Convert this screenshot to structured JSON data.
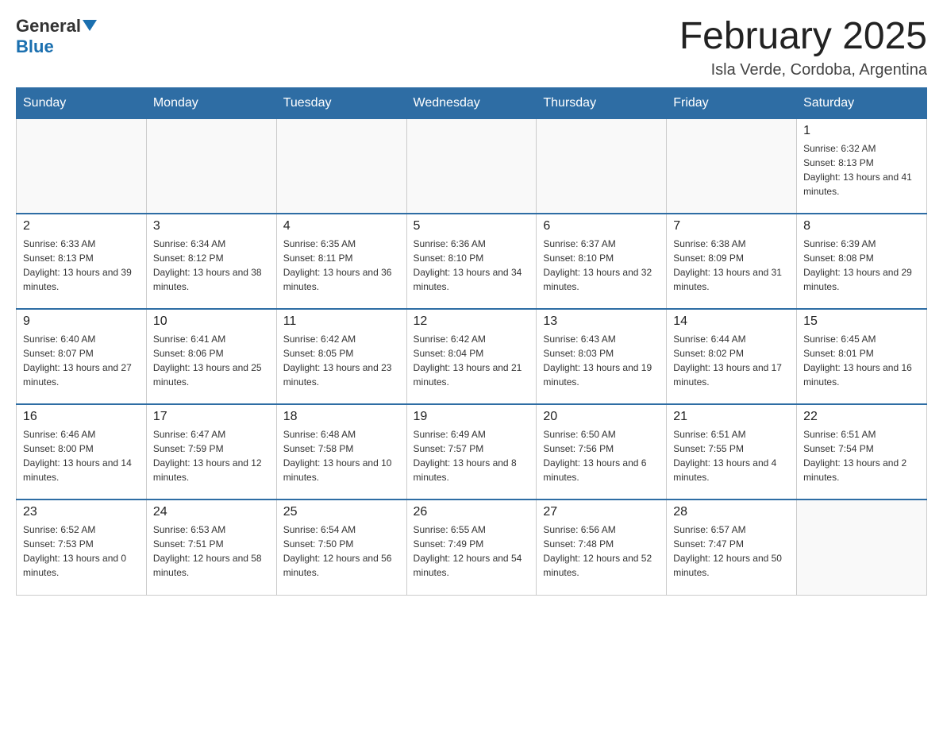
{
  "header": {
    "logo": {
      "general": "General",
      "arrow": "▲",
      "blue": "Blue"
    },
    "title": "February 2025",
    "location": "Isla Verde, Cordoba, Argentina"
  },
  "calendar": {
    "days_of_week": [
      "Sunday",
      "Monday",
      "Tuesday",
      "Wednesday",
      "Thursday",
      "Friday",
      "Saturday"
    ],
    "weeks": [
      [
        {
          "day": "",
          "info": ""
        },
        {
          "day": "",
          "info": ""
        },
        {
          "day": "",
          "info": ""
        },
        {
          "day": "",
          "info": ""
        },
        {
          "day": "",
          "info": ""
        },
        {
          "day": "",
          "info": ""
        },
        {
          "day": "1",
          "info": "Sunrise: 6:32 AM\nSunset: 8:13 PM\nDaylight: 13 hours and 41 minutes."
        }
      ],
      [
        {
          "day": "2",
          "info": "Sunrise: 6:33 AM\nSunset: 8:13 PM\nDaylight: 13 hours and 39 minutes."
        },
        {
          "day": "3",
          "info": "Sunrise: 6:34 AM\nSunset: 8:12 PM\nDaylight: 13 hours and 38 minutes."
        },
        {
          "day": "4",
          "info": "Sunrise: 6:35 AM\nSunset: 8:11 PM\nDaylight: 13 hours and 36 minutes."
        },
        {
          "day": "5",
          "info": "Sunrise: 6:36 AM\nSunset: 8:10 PM\nDaylight: 13 hours and 34 minutes."
        },
        {
          "day": "6",
          "info": "Sunrise: 6:37 AM\nSunset: 8:10 PM\nDaylight: 13 hours and 32 minutes."
        },
        {
          "day": "7",
          "info": "Sunrise: 6:38 AM\nSunset: 8:09 PM\nDaylight: 13 hours and 31 minutes."
        },
        {
          "day": "8",
          "info": "Sunrise: 6:39 AM\nSunset: 8:08 PM\nDaylight: 13 hours and 29 minutes."
        }
      ],
      [
        {
          "day": "9",
          "info": "Sunrise: 6:40 AM\nSunset: 8:07 PM\nDaylight: 13 hours and 27 minutes."
        },
        {
          "day": "10",
          "info": "Sunrise: 6:41 AM\nSunset: 8:06 PM\nDaylight: 13 hours and 25 minutes."
        },
        {
          "day": "11",
          "info": "Sunrise: 6:42 AM\nSunset: 8:05 PM\nDaylight: 13 hours and 23 minutes."
        },
        {
          "day": "12",
          "info": "Sunrise: 6:42 AM\nSunset: 8:04 PM\nDaylight: 13 hours and 21 minutes."
        },
        {
          "day": "13",
          "info": "Sunrise: 6:43 AM\nSunset: 8:03 PM\nDaylight: 13 hours and 19 minutes."
        },
        {
          "day": "14",
          "info": "Sunrise: 6:44 AM\nSunset: 8:02 PM\nDaylight: 13 hours and 17 minutes."
        },
        {
          "day": "15",
          "info": "Sunrise: 6:45 AM\nSunset: 8:01 PM\nDaylight: 13 hours and 16 minutes."
        }
      ],
      [
        {
          "day": "16",
          "info": "Sunrise: 6:46 AM\nSunset: 8:00 PM\nDaylight: 13 hours and 14 minutes."
        },
        {
          "day": "17",
          "info": "Sunrise: 6:47 AM\nSunset: 7:59 PM\nDaylight: 13 hours and 12 minutes."
        },
        {
          "day": "18",
          "info": "Sunrise: 6:48 AM\nSunset: 7:58 PM\nDaylight: 13 hours and 10 minutes."
        },
        {
          "day": "19",
          "info": "Sunrise: 6:49 AM\nSunset: 7:57 PM\nDaylight: 13 hours and 8 minutes."
        },
        {
          "day": "20",
          "info": "Sunrise: 6:50 AM\nSunset: 7:56 PM\nDaylight: 13 hours and 6 minutes."
        },
        {
          "day": "21",
          "info": "Sunrise: 6:51 AM\nSunset: 7:55 PM\nDaylight: 13 hours and 4 minutes."
        },
        {
          "day": "22",
          "info": "Sunrise: 6:51 AM\nSunset: 7:54 PM\nDaylight: 13 hours and 2 minutes."
        }
      ],
      [
        {
          "day": "23",
          "info": "Sunrise: 6:52 AM\nSunset: 7:53 PM\nDaylight: 13 hours and 0 minutes."
        },
        {
          "day": "24",
          "info": "Sunrise: 6:53 AM\nSunset: 7:51 PM\nDaylight: 12 hours and 58 minutes."
        },
        {
          "day": "25",
          "info": "Sunrise: 6:54 AM\nSunset: 7:50 PM\nDaylight: 12 hours and 56 minutes."
        },
        {
          "day": "26",
          "info": "Sunrise: 6:55 AM\nSunset: 7:49 PM\nDaylight: 12 hours and 54 minutes."
        },
        {
          "day": "27",
          "info": "Sunrise: 6:56 AM\nSunset: 7:48 PM\nDaylight: 12 hours and 52 minutes."
        },
        {
          "day": "28",
          "info": "Sunrise: 6:57 AM\nSunset: 7:47 PM\nDaylight: 12 hours and 50 minutes."
        },
        {
          "day": "",
          "info": ""
        }
      ]
    ]
  }
}
